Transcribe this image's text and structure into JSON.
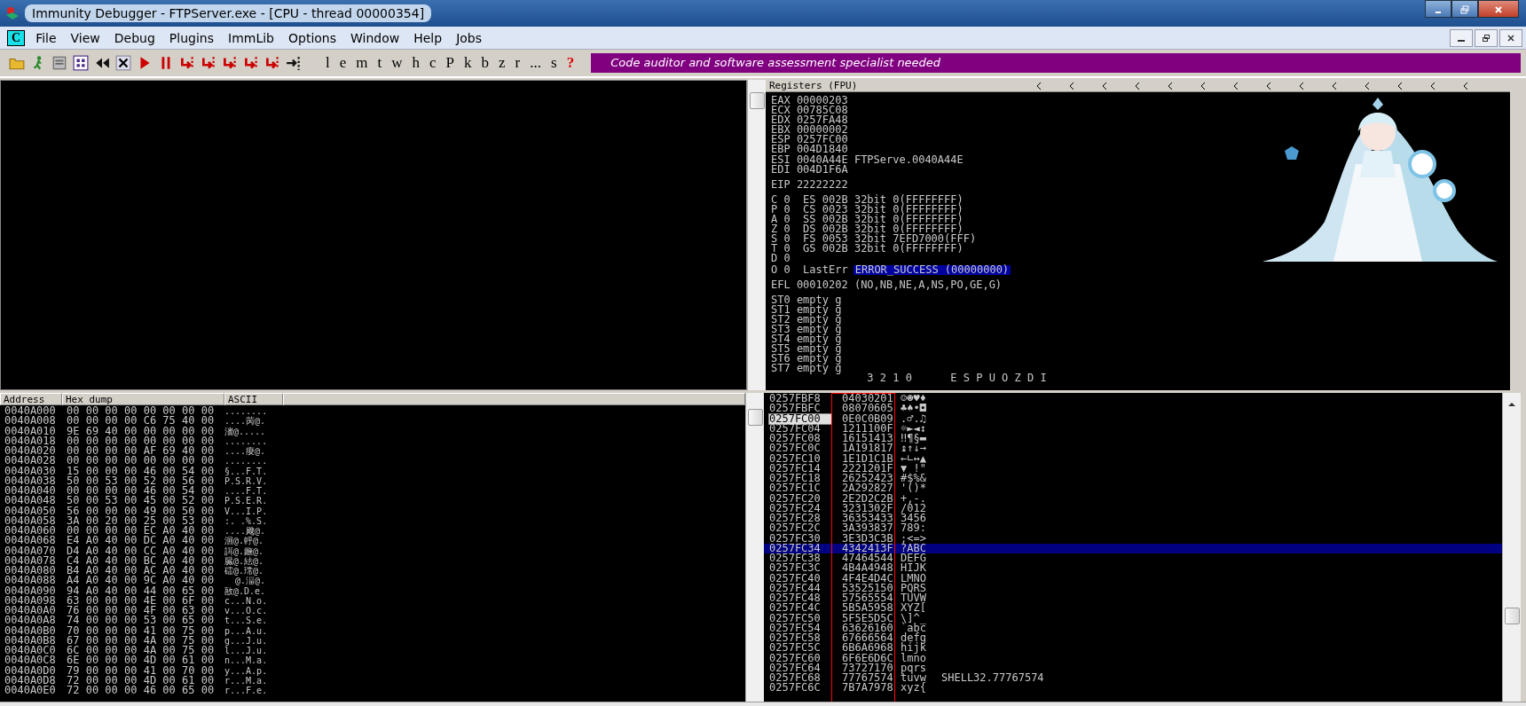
{
  "window": {
    "title": "Immunity Debugger - FTPServer.exe - [CPU - thread 00000354]"
  },
  "menu": [
    {
      "label": "File"
    },
    {
      "label": "View"
    },
    {
      "label": "Debug"
    },
    {
      "label": "Plugins"
    },
    {
      "label": "ImmLib"
    },
    {
      "label": "Options"
    },
    {
      "label": "Window"
    },
    {
      "label": "Help"
    },
    {
      "label": "Jobs"
    }
  ],
  "menu_logo": "C",
  "toolbar_letters": [
    {
      "label": "l",
      "kind": "letter"
    },
    {
      "label": "e",
      "kind": "letter"
    },
    {
      "label": "m",
      "kind": "letter"
    },
    {
      "label": "t",
      "kind": "letter"
    },
    {
      "label": "w",
      "kind": "letter"
    },
    {
      "label": "h",
      "kind": "letter"
    },
    {
      "label": "c",
      "kind": "letter"
    },
    {
      "label": "P",
      "kind": "letter"
    },
    {
      "label": "k",
      "kind": "letter"
    },
    {
      "label": "b",
      "kind": "letter"
    },
    {
      "label": "z",
      "kind": "letter"
    },
    {
      "label": "r",
      "kind": "letter"
    },
    {
      "label": "...",
      "kind": "letter"
    },
    {
      "label": "s",
      "kind": "letter"
    },
    {
      "label": "?",
      "kind": "help"
    }
  ],
  "banner": "Code auditor and software assessment specialist needed",
  "registers": {
    "title": "Registers (FPU)",
    "groups": [
      [
        {
          "text": "EAX 00000203"
        },
        {
          "text": "ECX 00785C08"
        },
        {
          "text": "EDX 0257FA48"
        },
        {
          "text": "EBX 00000002"
        },
        {
          "text": "ESP 0257FC00"
        },
        {
          "text": "EBP 004D1840"
        },
        {
          "text": "ESI 0040A44E FTPServe.0040A44E"
        },
        {
          "text": "EDI 004D1F6A"
        }
      ],
      [
        {
          "text": "EIP 22222222"
        }
      ],
      [
        {
          "text": "C 0  ES 002B 32bit 0(FFFFFFFF)"
        },
        {
          "text": "P 0  CS 0023 32bit 0(FFFFFFFF)"
        },
        {
          "text": "A 0  SS 002B 32bit 0(FFFFFFFF)"
        },
        {
          "text": "Z 0  DS 002B 32bit 0(FFFFFFFF)"
        },
        {
          "text": "S 0  FS 0053 32bit 7EFD7000(FFF)"
        },
        {
          "text": "T 0  GS 002B 32bit 0(FFFFFFFF)"
        },
        {
          "text": "D 0"
        },
        {
          "text": "O 0  LastErr",
          "highlight": "ERROR_SUCCESS (00000000)"
        }
      ],
      [
        {
          "text": "EFL 00010202 (NO,NB,NE,A,NS,PO,GE,G)"
        }
      ],
      [
        {
          "text": "ST0 empty g"
        },
        {
          "text": "ST1 empty g"
        },
        {
          "text": "ST2 empty g"
        },
        {
          "text": "ST3 empty g"
        },
        {
          "text": "ST4 empty g"
        },
        {
          "text": "ST5 empty g"
        },
        {
          "text": "ST6 empty g"
        },
        {
          "text": "ST7 empty g"
        },
        {
          "text": "               3 2 1 0      E S P U O Z D I"
        }
      ]
    ]
  },
  "dump": {
    "columns": [
      "Address",
      "Hex dump",
      "ASCII"
    ],
    "rows": [
      {
        "address": "0040A000",
        "hex": "00 00 00 00 00 00 00 00",
        "ascii": "........"
      },
      {
        "address": "0040A008",
        "hex": "00 00 00 00 C6 75 40 00",
        "ascii": "....苪@."
      },
      {
        "address": "0040A010",
        "hex": "9E 69 40 00 00 00 00 00",
        "ascii": "瀒@....."
      },
      {
        "address": "0040A018",
        "hex": "00 00 00 00 00 00 00 00",
        "ascii": "........"
      },
      {
        "address": "0040A020",
        "hex": "00 00 00 00 AF 69 40 00",
        "ascii": "....痠@."
      },
      {
        "address": "0040A028",
        "hex": "00 00 00 00 00 00 00 00",
        "ascii": "........"
      },
      {
        "address": "0040A030",
        "hex": "15 00 00 00 46 00 54 00",
        "ascii": "§...F.T."
      },
      {
        "address": "0040A038",
        "hex": "50 00 53 00 52 00 56 00",
        "ascii": "P.S.R.V."
      },
      {
        "address": "0040A040",
        "hex": "00 00 00 00 46 00 54 00",
        "ascii": "....F.T."
      },
      {
        "address": "0040A048",
        "hex": "50 00 53 00 45 00 52 00",
        "ascii": "P.S.E.R."
      },
      {
        "address": "0040A050",
        "hex": "56 00 00 00 49 00 50 00",
        "ascii": "V...I.P."
      },
      {
        "address": "0040A058",
        "hex": "3A 00 20 00 25 00 53 00",
        "ascii": ":. .%.S."
      },
      {
        "address": "0040A060",
        "hex": "00 00 00 00 EC A0 40 00",
        "ascii": "....飕@."
      },
      {
        "address": "0040A068",
        "hex": "E4 A0 40 00 DC A0 40 00",
        "ascii": "洄@.軤@."
      },
      {
        "address": "0040A070",
        "hex": "D4 A0 40 00 CC A0 40 00",
        "ascii": "誀@.虪@."
      },
      {
        "address": "0040A078",
        "hex": "C4 A0 40 00 BC A0 40 00",
        "ascii": "臓@.紶@."
      },
      {
        "address": "0040A080",
        "hex": "B4 A0 40 00 AC A0 40 00",
        "ascii": "礌@.瑺@."
      },
      {
        "address": "0040A088",
        "hex": "A4 A0 40 00 9C A0 40 00",
        "ascii": "  @.湢@."
      },
      {
        "address": "0040A090",
        "hex": "94 A0 40 00 44 00 65 00",
        "ascii": "敔@.D.e."
      },
      {
        "address": "0040A098",
        "hex": "63 00 00 00 4E 00 6F 00",
        "ascii": "c...N.o."
      },
      {
        "address": "0040A0A0",
        "hex": "76 00 00 00 4F 00 63 00",
        "ascii": "v...O.c."
      },
      {
        "address": "0040A0A8",
        "hex": "74 00 00 00 53 00 65 00",
        "ascii": "t...S.e."
      },
      {
        "address": "0040A0B0",
        "hex": "70 00 00 00 41 00 75 00",
        "ascii": "p...A.u."
      },
      {
        "address": "0040A0B8",
        "hex": "67 00 00 00 4A 00 75 00",
        "ascii": "g...J.u."
      },
      {
        "address": "0040A0C0",
        "hex": "6C 00 00 00 4A 00 75 00",
        "ascii": "l...J.u."
      },
      {
        "address": "0040A0C8",
        "hex": "6E 00 00 00 4D 00 61 00",
        "ascii": "n...M.a."
      },
      {
        "address": "0040A0D0",
        "hex": "79 00 00 00 41 00 70 00",
        "ascii": "y...A.p."
      },
      {
        "address": "0040A0D8",
        "hex": "72 00 00 00 4D 00 61 00",
        "ascii": "r...M.a."
      },
      {
        "address": "0040A0E0",
        "hex": "72 00 00 00 46 00 65 00",
        "ascii": "r...F.e."
      }
    ]
  },
  "stack": {
    "rows": [
      {
        "address": "0257FBF8",
        "value": "04030201",
        "ascii": "☺☻♥♦",
        "selected": false,
        "top": false
      },
      {
        "address": "0257FBFC",
        "value": "08070605",
        "ascii": "♣♠•◘",
        "selected": false,
        "top": false
      },
      {
        "address": "0257FC00",
        "value": "0E0C0B09",
        "ascii": ".♂.♫",
        "selected": false,
        "top": true
      },
      {
        "address": "0257FC04",
        "value": "1211100F",
        "ascii": "☼►◄↕",
        "selected": false,
        "top": false
      },
      {
        "address": "0257FC08",
        "value": "16151413",
        "ascii": "‼¶§▬",
        "selected": false,
        "top": false
      },
      {
        "address": "0257FC0C",
        "value": "1A191817",
        "ascii": "↨↑↓→",
        "selected": false,
        "top": false
      },
      {
        "address": "0257FC10",
        "value": "1E1D1C1B",
        "ascii": "←∟↔▲",
        "selected": false,
        "top": false
      },
      {
        "address": "0257FC14",
        "value": "2221201F",
        "ascii": "▼ !\"",
        "selected": false,
        "top": false
      },
      {
        "address": "0257FC18",
        "value": "26252423",
        "ascii": "#$%&",
        "selected": false,
        "top": false
      },
      {
        "address": "0257FC1C",
        "value": "2A292827",
        "ascii": "'()*",
        "selected": false,
        "top": false
      },
      {
        "address": "0257FC20",
        "value": "2E2D2C2B",
        "ascii": "+,-.",
        "selected": false,
        "top": false
      },
      {
        "address": "0257FC24",
        "value": "3231302F",
        "ascii": "/012",
        "selected": false,
        "top": false
      },
      {
        "address": "0257FC28",
        "value": "36353433",
        "ascii": "3456",
        "selected": false,
        "top": false
      },
      {
        "address": "0257FC2C",
        "value": "3A393837",
        "ascii": "789:",
        "selected": false,
        "top": false
      },
      {
        "address": "0257FC30",
        "value": "3E3D3C3B",
        "ascii": ";<=>",
        "selected": false,
        "top": false
      },
      {
        "address": "0257FC34",
        "value": "4342413F",
        "ascii": "?ABC",
        "selected": true,
        "top": false
      },
      {
        "address": "0257FC38",
        "value": "47464544",
        "ascii": "DEFG",
        "selected": false,
        "top": false
      },
      {
        "address": "0257FC3C",
        "value": "4B4A4948",
        "ascii": "HIJK",
        "selected": false,
        "top": false
      },
      {
        "address": "0257FC40",
        "value": "4F4E4D4C",
        "ascii": "LMNO",
        "selected": false,
        "top": false
      },
      {
        "address": "0257FC44",
        "value": "53525150",
        "ascii": "PQRS",
        "selected": false,
        "top": false
      },
      {
        "address": "0257FC48",
        "value": "57565554",
        "ascii": "TUVW",
        "selected": false,
        "top": false
      },
      {
        "address": "0257FC4C",
        "value": "5B5A5958",
        "ascii": "XYZ[",
        "selected": false,
        "top": false
      },
      {
        "address": "0257FC50",
        "value": "5F5E5D5C",
        "ascii": "\\]^_",
        "selected": false,
        "top": false
      },
      {
        "address": "0257FC54",
        "value": "63626160",
        "ascii": "`abc",
        "selected": false,
        "top": false
      },
      {
        "address": "0257FC58",
        "value": "67666564",
        "ascii": "defg",
        "selected": false,
        "top": false
      },
      {
        "address": "0257FC5C",
        "value": "6B6A6968",
        "ascii": "hijk",
        "selected": false,
        "top": false
      },
      {
        "address": "0257FC60",
        "value": "6F6E6D6C",
        "ascii": "lmno",
        "selected": false,
        "top": false
      },
      {
        "address": "0257FC64",
        "value": "73727170",
        "ascii": "pqrs",
        "selected": false,
        "top": false
      },
      {
        "address": "0257FC68",
        "value": "77767574",
        "ascii": "tuvw",
        "comment": "SHELL32.77767574",
        "selected": false,
        "top": false
      },
      {
        "address": "0257FC6C",
        "value": "7B7A7978",
        "ascii": "xyz{",
        "selected": false,
        "top": false
      }
    ]
  }
}
